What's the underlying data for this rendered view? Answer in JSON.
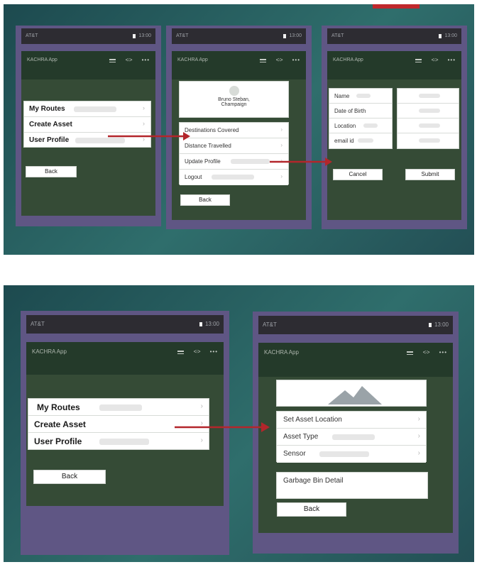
{
  "colors": {
    "panel": "#2f6e6c",
    "phone": "#5f5684",
    "content": "#354b36",
    "appbar": "#243a2a",
    "arrow": "#b3262b"
  },
  "status": {
    "carrier": "AT&T",
    "time": "13:00"
  },
  "app": {
    "title": "KACHRA App",
    "icons": [
      "person-icon",
      "share-icon",
      "more-icon"
    ]
  },
  "screen1": {
    "menu": [
      "My Routes",
      "Create Asset",
      "User Profile"
    ],
    "back": "Back"
  },
  "screen2": {
    "profile_name": "Bruno Steban,",
    "profile_city": "Champaign",
    "menu": [
      "Destinations Covered",
      "Distance Travelled",
      "Update Profile",
      "Logout"
    ],
    "back": "Back"
  },
  "screen3": {
    "fields": [
      "Name",
      "Date of Birth",
      "Location",
      "email id"
    ],
    "cancel": "Cancel",
    "submit": "Submit"
  },
  "screen4": {
    "menu": [
      "My Routes",
      "Create Asset",
      "User Profile"
    ],
    "back": "Back"
  },
  "screen5": {
    "menu": [
      "Set Asset Location",
      "Asset Type",
      "Sensor"
    ],
    "detail": "Garbage Bin Detail",
    "back": "Back"
  }
}
